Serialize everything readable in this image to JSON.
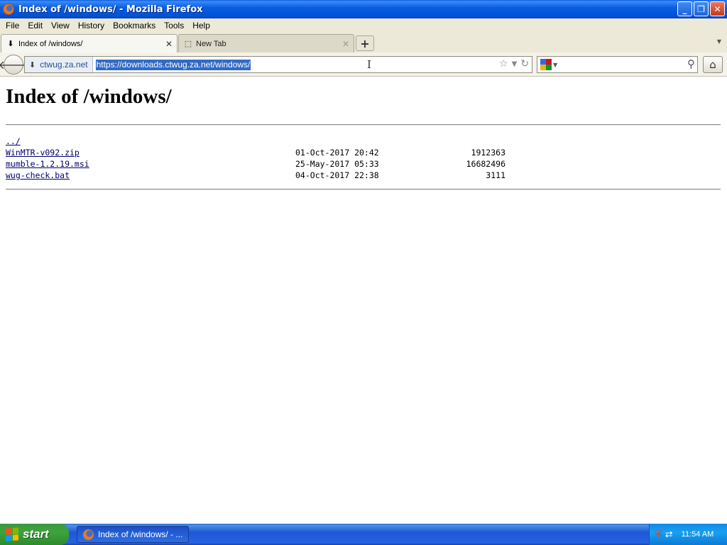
{
  "window": {
    "title": "Index of /windows/ - Mozilla Firefox",
    "minimize_glyph": "_",
    "maximize_glyph": "❐",
    "close_glyph": "✕"
  },
  "menu": [
    "File",
    "Edit",
    "View",
    "History",
    "Bookmarks",
    "Tools",
    "Help"
  ],
  "tabs": [
    {
      "label": "Index of /windows/",
      "active": true
    },
    {
      "label": "New Tab",
      "active": false
    }
  ],
  "tab_close_glyph": "✕",
  "new_tab_glyph": "+",
  "navbar": {
    "identity": "ctwug.za.net",
    "url": "https://downloads.ctwug.za.net/windows/",
    "search_placeholder": ""
  },
  "page": {
    "heading": "Index of /windows/",
    "parent_link": "../",
    "files": [
      {
        "name": "WinMTR-v092.zip",
        "date": "01-Oct-2017 20:42",
        "size": "1912363"
      },
      {
        "name": "mumble-1.2.19.msi",
        "date": "25-May-2017 05:33",
        "size": "16682496"
      },
      {
        "name": "wug-check.bat",
        "date": "04-Oct-2017 22:38",
        "size": "3111"
      }
    ]
  },
  "taskbar": {
    "start_label": "start",
    "task_label": "Index of /windows/ - ...",
    "clock": "11:54 AM"
  },
  "colors": {
    "titlebar": "#0a5fe0",
    "link": "#00006e",
    "url_selection": "#316ac5",
    "start_button": "#3da33d"
  },
  "icons": [
    "firefox-icon",
    "download-icon",
    "back-arrow-icon",
    "star-icon",
    "reload-icon",
    "google-icon",
    "magnifier-icon",
    "home-icon",
    "windows-flag-icon",
    "shield-icon",
    "network-icon"
  ]
}
